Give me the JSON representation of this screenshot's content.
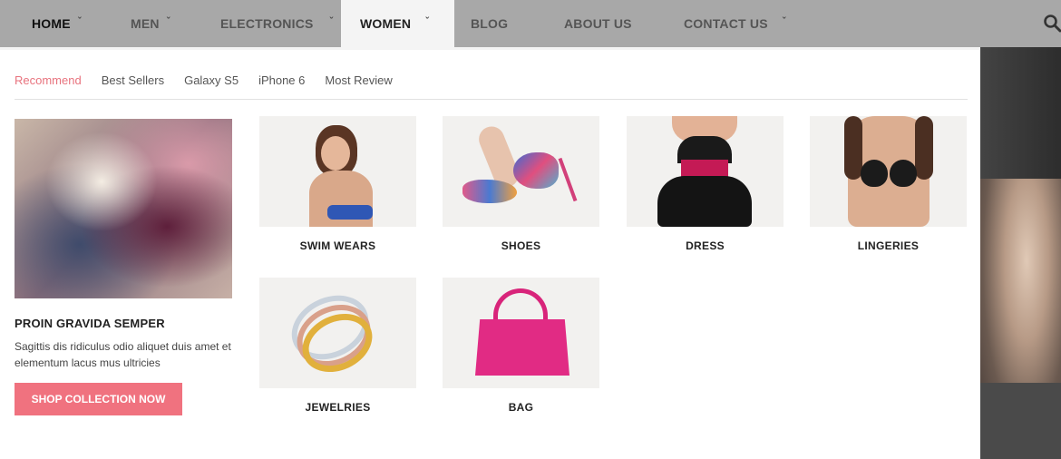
{
  "nav": {
    "items": [
      {
        "label": "HOME",
        "has_dropdown": true
      },
      {
        "label": "MEN",
        "has_dropdown": true
      },
      {
        "label": "ELECTRONICS",
        "has_dropdown": true
      },
      {
        "label": "WOMEN",
        "has_dropdown": true,
        "active": true
      },
      {
        "label": "BLOG",
        "has_dropdown": false
      },
      {
        "label": "ABOUT US",
        "has_dropdown": false
      },
      {
        "label": "CONTACT US",
        "has_dropdown": true
      }
    ],
    "search_icon": "search-icon"
  },
  "mega": {
    "tabs": [
      "Recommend",
      "Best Sellers",
      "Galaxy S5",
      "iPhone 6",
      "Most Review"
    ],
    "active_tab": "Recommend",
    "promo": {
      "title": "PROIN GRAVIDA SEMPER",
      "text": "Sagittis dis ridiculus odio aliquet duis amet et elementum lacus mus ultricies",
      "button": "SHOP COLLECTION NOW"
    },
    "categories": [
      {
        "label": "SWIM WEARS"
      },
      {
        "label": "SHOES"
      },
      {
        "label": "DRESS"
      },
      {
        "label": "LINGERIES"
      },
      {
        "label": "JEWELRIES"
      },
      {
        "label": "BAG"
      }
    ]
  },
  "colors": {
    "accent": "#f0727f",
    "active_tab": "#e8737e",
    "nav_bg": "#a8a8a8"
  }
}
